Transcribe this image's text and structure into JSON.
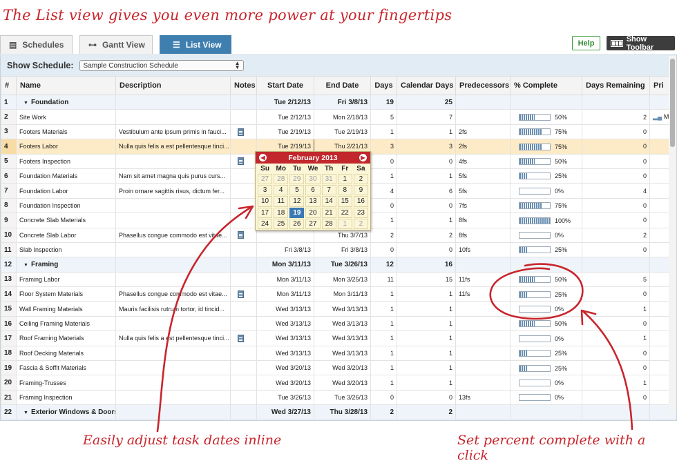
{
  "headline": "The List view gives you even more power at your fingertips",
  "tabs": [
    {
      "label": "Schedules",
      "icon": "schedule-icon"
    },
    {
      "label": "Gantt View",
      "icon": "gantt-icon"
    },
    {
      "label": "List View",
      "icon": "list-icon"
    }
  ],
  "help_label": "Help",
  "toolbar_label": "Show Toolbar",
  "show_schedule_label": "Show Schedule:",
  "schedule_select": "Sample Construction Schedule",
  "columns": [
    "#",
    "Name",
    "Description",
    "Notes",
    "Start Date",
    "End Date",
    "Days",
    "Calendar Days",
    "Predecessors",
    "% Complete",
    "Days Remaining",
    "Pri"
  ],
  "rows": [
    {
      "n": "1",
      "name": "Foundation",
      "desc": "",
      "note": false,
      "start": "Tue 2/12/13",
      "end": "Fri 3/8/13",
      "days": "19",
      "cal": "25",
      "pred": "",
      "pct": "",
      "remain": "",
      "group": true
    },
    {
      "n": "2",
      "name": "Site Work",
      "desc": "",
      "note": false,
      "start": "Tue 2/12/13",
      "end": "Mon 2/18/13",
      "days": "5",
      "cal": "7",
      "pred": "",
      "pct": "50%",
      "remain": "2"
    },
    {
      "n": "3",
      "name": "Footers Materials",
      "desc": "Vestibulum ante ipsum primis in fauci...",
      "note": true,
      "start": "Tue 2/19/13",
      "end": "Tue 2/19/13",
      "days": "1",
      "cal": "1",
      "pred": "2fs",
      "pct": "75%",
      "remain": "0"
    },
    {
      "n": "4",
      "name": "Footers Labor",
      "desc": "Nulla quis felis a est pellentesque tinci...",
      "note": false,
      "start": "Tue 2/19/13",
      "end": "Thu 2/21/13",
      "days": "3",
      "cal": "3",
      "pred": "2fs",
      "pct": "75%",
      "remain": "0",
      "selected": true
    },
    {
      "n": "5",
      "name": "Footers Inspection",
      "desc": "",
      "note": true,
      "start": "",
      "end": "",
      "days": "0",
      "cal": "0",
      "pred": "4fs",
      "pct": "50%",
      "remain": "0"
    },
    {
      "n": "6",
      "name": "Foundation Materials",
      "desc": "Nam sit amet magna quis purus curs...",
      "note": false,
      "start": "",
      "end": "",
      "days": "1",
      "cal": "1",
      "pred": "5fs",
      "pct": "25%",
      "remain": "0"
    },
    {
      "n": "7",
      "name": "Foundation Labor",
      "desc": "Proin ornare sagittis risus, dictum fer...",
      "note": false,
      "start": "",
      "end": "",
      "days": "4",
      "cal": "6",
      "pred": "5fs",
      "pct": "0%",
      "remain": "4"
    },
    {
      "n": "8",
      "name": "Foundation Inspection",
      "desc": "",
      "note": false,
      "start": "",
      "end": "",
      "days": "0",
      "cal": "0",
      "pred": "7fs",
      "pct": "75%",
      "remain": "0"
    },
    {
      "n": "9",
      "name": "Concrete Slab Materials",
      "desc": "",
      "note": false,
      "start": "",
      "end": "",
      "days": "1",
      "cal": "1",
      "pred": "8fs",
      "pct": "100%",
      "remain": "0"
    },
    {
      "n": "10",
      "name": "Concrete Slab Labor",
      "desc": "Phasellus congue commodo est vitae...",
      "note": true,
      "start": "",
      "end": "Thu 3/7/13",
      "days": "2",
      "cal": "2",
      "pred": "8fs",
      "pct": "0%",
      "remain": "2"
    },
    {
      "n": "11",
      "name": "Slab Inspection",
      "desc": "",
      "note": false,
      "start": "Fri 3/8/13",
      "end": "Fri 3/8/13",
      "days": "0",
      "cal": "0",
      "pred": "10fs",
      "pct": "25%",
      "remain": "0"
    },
    {
      "n": "12",
      "name": "Framing",
      "desc": "",
      "note": false,
      "start": "Mon 3/11/13",
      "end": "Tue 3/26/13",
      "days": "12",
      "cal": "16",
      "pred": "",
      "pct": "",
      "remain": "",
      "group": true
    },
    {
      "n": "13",
      "name": "Framing Labor",
      "desc": "",
      "note": false,
      "start": "Mon 3/11/13",
      "end": "Mon 3/25/13",
      "days": "11",
      "cal": "15",
      "pred": "11fs",
      "pct": "50%",
      "remain": "5"
    },
    {
      "n": "14",
      "name": "Floor System Materials",
      "desc": "Phasellus congue commodo est vitae...",
      "note": true,
      "start": "Mon 3/11/13",
      "end": "Mon 3/11/13",
      "days": "1",
      "cal": "1",
      "pred": "11fs",
      "pct": "25%",
      "remain": "0"
    },
    {
      "n": "15",
      "name": "Wall Framing Materials",
      "desc": "Mauris facilisis rutrum tortor, id tincid...",
      "note": false,
      "start": "Wed 3/13/13",
      "end": "Wed 3/13/13",
      "days": "1",
      "cal": "1",
      "pred": "",
      "pct": "0%",
      "remain": "1"
    },
    {
      "n": "16",
      "name": "Ceiling Framing Materials",
      "desc": "",
      "note": false,
      "start": "Wed 3/13/13",
      "end": "Wed 3/13/13",
      "days": "1",
      "cal": "1",
      "pred": "",
      "pct": "50%",
      "remain": "0"
    },
    {
      "n": "17",
      "name": "Roof Framing Materials",
      "desc": "Nulla quis felis a est pellentesque tinci...",
      "note": true,
      "start": "Wed 3/13/13",
      "end": "Wed 3/13/13",
      "days": "1",
      "cal": "1",
      "pred": "",
      "pct": "0%",
      "remain": "1"
    },
    {
      "n": "18",
      "name": "Roof Decking Materials",
      "desc": "",
      "note": false,
      "start": "Wed 3/13/13",
      "end": "Wed 3/13/13",
      "days": "1",
      "cal": "1",
      "pred": "",
      "pct": "25%",
      "remain": "0"
    },
    {
      "n": "19",
      "name": "Fascia & Soffit Materials",
      "desc": "",
      "note": false,
      "start": "Wed 3/20/13",
      "end": "Wed 3/20/13",
      "days": "1",
      "cal": "1",
      "pred": "",
      "pct": "25%",
      "remain": "0"
    },
    {
      "n": "20",
      "name": "Framing-Trusses",
      "desc": "",
      "note": false,
      "start": "Wed 3/20/13",
      "end": "Wed 3/20/13",
      "days": "1",
      "cal": "1",
      "pred": "",
      "pct": "0%",
      "remain": "1"
    },
    {
      "n": "21",
      "name": "Framing Inspection",
      "desc": "",
      "note": false,
      "start": "Tue 3/26/13",
      "end": "Tue 3/26/13",
      "days": "0",
      "cal": "0",
      "pred": "13fs",
      "pct": "0%",
      "remain": "0"
    },
    {
      "n": "22",
      "name": "Exterior Windows & Doors",
      "desc": "",
      "note": false,
      "start": "Wed 3/27/13",
      "end": "Thu 3/28/13",
      "days": "2",
      "cal": "2",
      "pred": "",
      "pct": "",
      "remain": "",
      "group": true
    }
  ],
  "pri_row2": "M",
  "calendar": {
    "title": "February 2013",
    "dow": [
      "Su",
      "Mo",
      "Tu",
      "We",
      "Th",
      "Fr",
      "Sa"
    ],
    "weeks": [
      [
        {
          "d": "27",
          "m": true
        },
        {
          "d": "28",
          "m": true
        },
        {
          "d": "29",
          "m": true
        },
        {
          "d": "30",
          "m": true
        },
        {
          "d": "31",
          "m": true
        },
        {
          "d": "1"
        },
        {
          "d": "2"
        }
      ],
      [
        {
          "d": "3"
        },
        {
          "d": "4"
        },
        {
          "d": "5"
        },
        {
          "d": "6"
        },
        {
          "d": "7"
        },
        {
          "d": "8"
        },
        {
          "d": "9"
        }
      ],
      [
        {
          "d": "10"
        },
        {
          "d": "11"
        },
        {
          "d": "12"
        },
        {
          "d": "13"
        },
        {
          "d": "14"
        },
        {
          "d": "15"
        },
        {
          "d": "16"
        }
      ],
      [
        {
          "d": "17"
        },
        {
          "d": "18"
        },
        {
          "d": "19",
          "t": true
        },
        {
          "d": "20"
        },
        {
          "d": "21"
        },
        {
          "d": "22"
        },
        {
          "d": "23"
        }
      ],
      [
        {
          "d": "24"
        },
        {
          "d": "25"
        },
        {
          "d": "26"
        },
        {
          "d": "27"
        },
        {
          "d": "28"
        },
        {
          "d": "1",
          "m": true
        },
        {
          "d": "2",
          "m": true
        }
      ]
    ]
  },
  "caption_left": "Easily adjust task dates inline",
  "caption_right": "Set percent complete with a click",
  "colors": {
    "accent": "#c8252c",
    "tab_active": "#3f7fb0",
    "selected_row": "#fcebc6"
  }
}
